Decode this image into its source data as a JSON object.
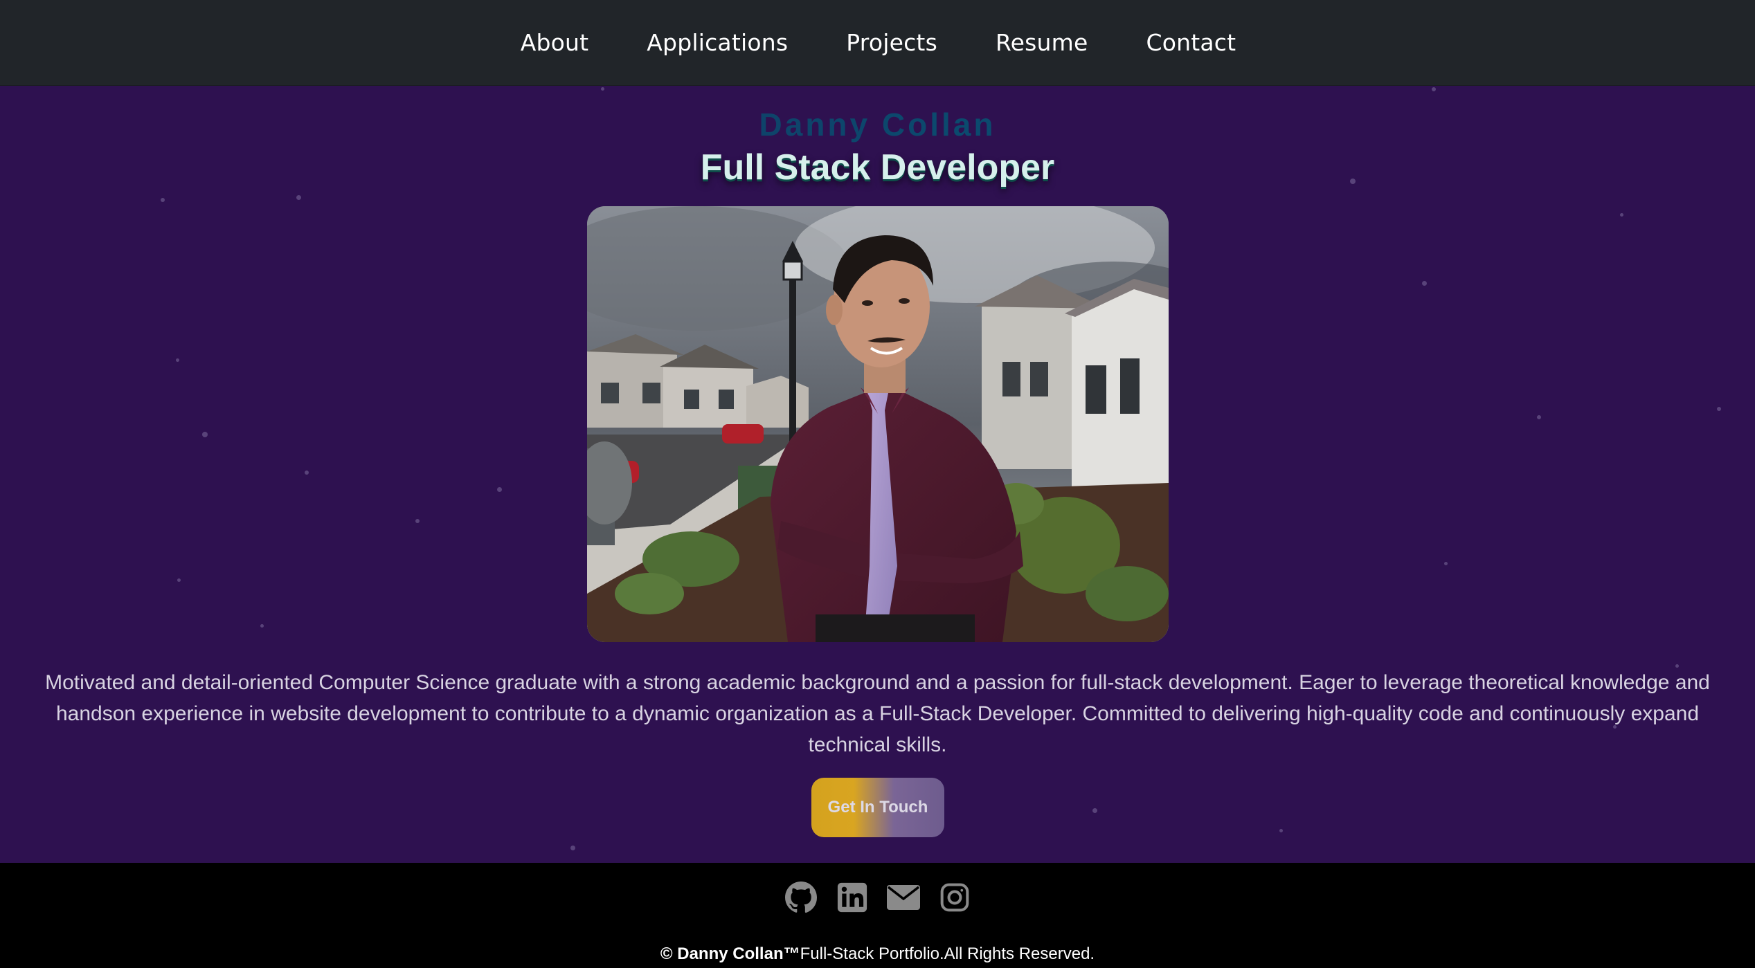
{
  "nav": {
    "items": [
      {
        "label": "About"
      },
      {
        "label": "Applications"
      },
      {
        "label": "Projects"
      },
      {
        "label": "Resume"
      },
      {
        "label": "Contact"
      }
    ]
  },
  "hero": {
    "name": "Danny Collan",
    "role": "Full Stack Developer",
    "summary": "Motivated and detail-oriented Computer Science graduate with a strong academic background and a passion for full-stack development. Eager to leverage theoretical knowledge and handson experience in website development to contribute to a dynamic organization as a Full-Stack Developer. Committed to delivering high-quality code and continuously expand technical skills.",
    "cta_label": "Get In Touch"
  },
  "footer": {
    "socials": [
      {
        "icon": "github-icon"
      },
      {
        "icon": "linkedin-icon"
      },
      {
        "icon": "email-icon"
      },
      {
        "icon": "instagram-icon"
      }
    ],
    "copyright_prefix": "© ",
    "copyright_name": "Danny Collan™",
    "copyright_text": "Full-Stack Portfolio.All Rights Reserved."
  },
  "colors": {
    "nav_bg": "#212529",
    "hero_bg": "#2e1150",
    "footer_bg": "#000000",
    "cta_gold": "#d4a21e",
    "cta_purple": "#6e5c8e",
    "icon_gray": "#808080"
  }
}
